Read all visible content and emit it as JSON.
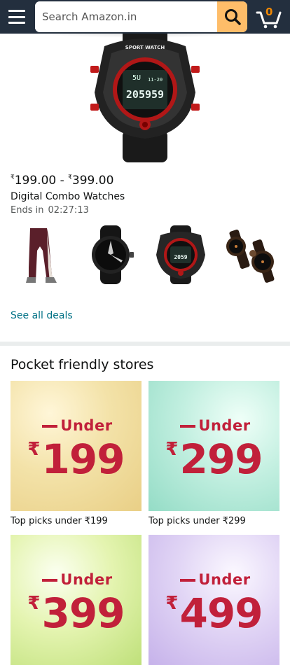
{
  "header": {
    "search_placeholder": "Search Amazon.in",
    "cart_count": "0",
    "icons": [
      "menu-icon",
      "search-icon",
      "cart-icon"
    ]
  },
  "deal": {
    "price_low_currency": "₹",
    "price_low": "199.00",
    "price_sep": "-",
    "price_high_currency": "₹",
    "price_high": "399.00",
    "title": "Digital Combo Watches",
    "ends_label": "Ends in",
    "ends_time": "02:27:13",
    "hero_watch_text": {
      "brand": "SPORT WATCH",
      "time": "20:59:59",
      "top": "11-20",
      "mode": "SU"
    },
    "see_all": "See all deals"
  },
  "section": {
    "title": "Pocket friendly stores"
  },
  "stores": [
    {
      "under": "Under",
      "currency": "₹",
      "amount": "199",
      "caption": "Top picks under ₹199",
      "bg": "#f5e6b9"
    },
    {
      "under": "Under",
      "currency": "₹",
      "amount": "299",
      "caption": "Top picks under ₹299",
      "bg": "#bfeee0"
    },
    {
      "under": "Under",
      "currency": "₹",
      "amount": "399",
      "caption": "",
      "bg": "#dff0a8"
    },
    {
      "under": "Under",
      "currency": "₹",
      "amount": "499",
      "caption": "",
      "bg": "#dccff2"
    }
  ],
  "colors": {
    "topbar": "#232f3e",
    "search_button": "#febd69",
    "link": "#007185",
    "cart_count": "#f08804",
    "banner_text": "#c1203a"
  }
}
